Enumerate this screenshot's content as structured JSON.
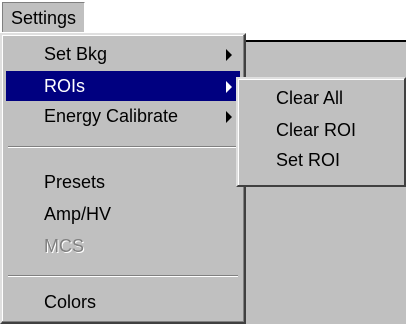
{
  "menubar": {
    "settings_label": "Settings"
  },
  "menu": {
    "items": [
      {
        "label": "Set Bkg",
        "submenu": true
      },
      {
        "label": "ROIs",
        "submenu": true,
        "highlighted": true
      },
      {
        "label": "Energy Calibrate",
        "submenu": true
      },
      {
        "label": "Presets"
      },
      {
        "label": "Amp/HV"
      },
      {
        "label": "MCS",
        "disabled": true
      },
      {
        "label": "Colors"
      }
    ]
  },
  "submenu": {
    "items": [
      {
        "label": "Clear All"
      },
      {
        "label": "Clear ROI"
      },
      {
        "label": "Set ROI"
      }
    ]
  },
  "colors": {
    "menu_background": "#c0c0c0",
    "highlight_background": "#000080",
    "highlight_text": "#ffffff",
    "disabled_text": "#808080"
  },
  "icons": {
    "submenu_arrow": "chevron-right-icon"
  }
}
